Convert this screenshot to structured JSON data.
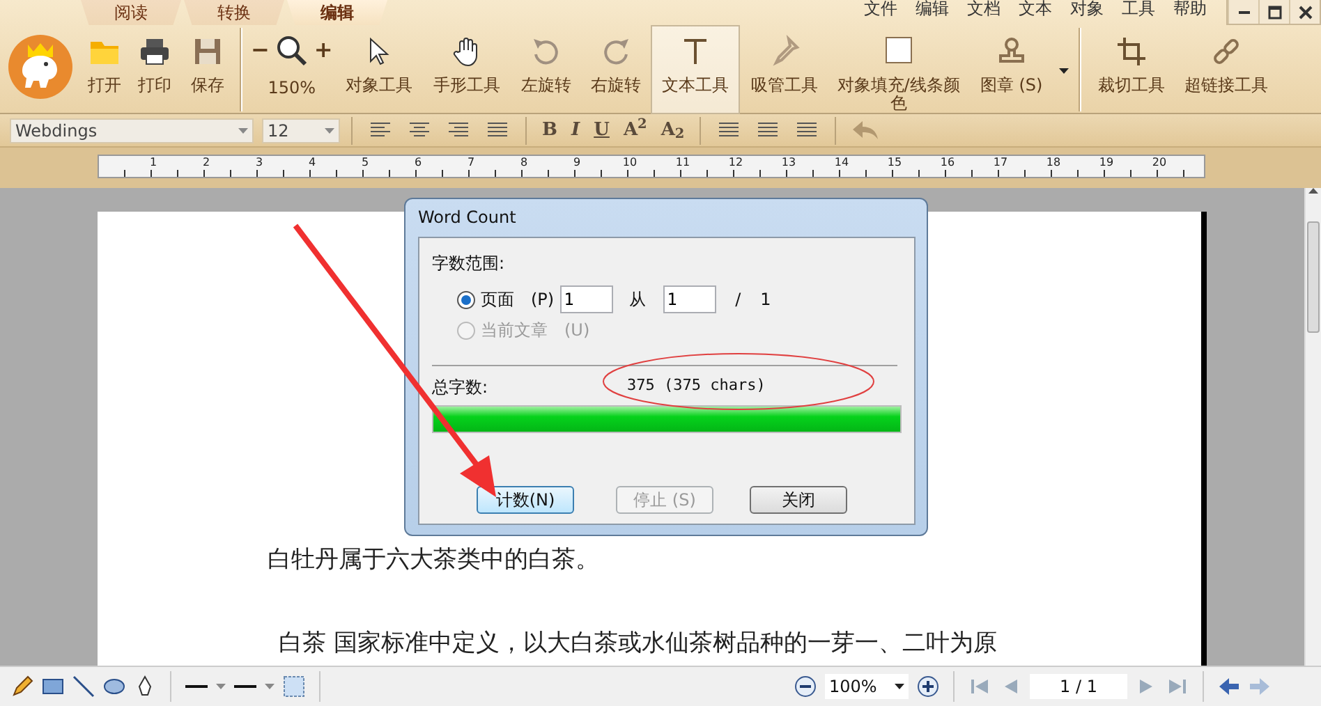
{
  "app_tabs": [
    {
      "label": "阅读",
      "selected": false
    },
    {
      "label": "转换",
      "selected": false
    },
    {
      "label": "编辑",
      "selected": true
    }
  ],
  "menu": [
    "文件",
    "编辑",
    "文档",
    "文本",
    "对象",
    "工具",
    "帮助"
  ],
  "toolbar": [
    {
      "kind": "open",
      "label": "打开",
      "selected": false
    },
    {
      "kind": "print",
      "label": "打印",
      "selected": false
    },
    {
      "kind": "save",
      "label": "保存",
      "selected": false
    },
    {
      "kind": "zoom",
      "label": "150%",
      "minus": "−",
      "plus": "+",
      "selected": false
    },
    {
      "kind": "select",
      "label": "对象工具",
      "selected": false
    },
    {
      "kind": "hand",
      "label": "手形工具",
      "selected": false
    },
    {
      "kind": "rotate_left",
      "label": "左旋转",
      "selected": false
    },
    {
      "kind": "rotate_right",
      "label": "右旋转",
      "selected": false
    },
    {
      "kind": "text",
      "label": "文本工具",
      "selected": true
    },
    {
      "kind": "eyedropper",
      "label": "吸管工具",
      "selected": false
    },
    {
      "kind": "fill",
      "label": "对象填充/线条颜色",
      "selected": false
    },
    {
      "kind": "stamp",
      "label": "图章 (S)",
      "selected": false
    },
    {
      "kind": "crop",
      "label": "裁切工具",
      "selected": false
    },
    {
      "kind": "link",
      "label": "超链接工具",
      "selected": false
    }
  ],
  "format_bar": {
    "font": "Webdings",
    "size": "12",
    "styles": [
      "B",
      "I",
      "U",
      "A$^{2}$",
      "A$_{2}$"
    ]
  },
  "ruler": [
    "1",
    "2",
    "3",
    "4",
    "5",
    "6",
    "7",
    "8",
    "9",
    "10",
    "11",
    "12",
    "13",
    "14",
    "15",
    "16",
    "17",
    "18",
    "19",
    "20"
  ],
  "document": {
    "paragraphs": [
      "白牡丹属于六大茶类中的白茶。",
      "白茶  国家标准中定义，以大白茶或水仙茶树品种的一芽一、二叶为原"
    ]
  },
  "dialog": {
    "title": "Word Count",
    "group_label": "字数范围:",
    "options": [
      {
        "label": "页面",
        "shortcut": "(P)",
        "selected": true,
        "disabled": false
      },
      {
        "label": "当前文章",
        "shortcut": "(U)",
        "selected": false,
        "disabled": true
      }
    ],
    "range": {
      "start": "1",
      "word": "从",
      "end": "1",
      "slash": "/",
      "total": "1"
    },
    "total_label": "总字数:",
    "total": "375 (375 chars)",
    "level": 1,
    "buttons": [
      {
        "label": "计数(N)",
        "focused": true,
        "disabled": false
      },
      {
        "label": "停止 (S)",
        "focused": false,
        "disabled": true
      },
      {
        "label": "关闭",
        "focused": false,
        "disabled": false
      }
    ]
  },
  "status_bar": {
    "zoom": "100%",
    "page": "1 / 1"
  }
}
